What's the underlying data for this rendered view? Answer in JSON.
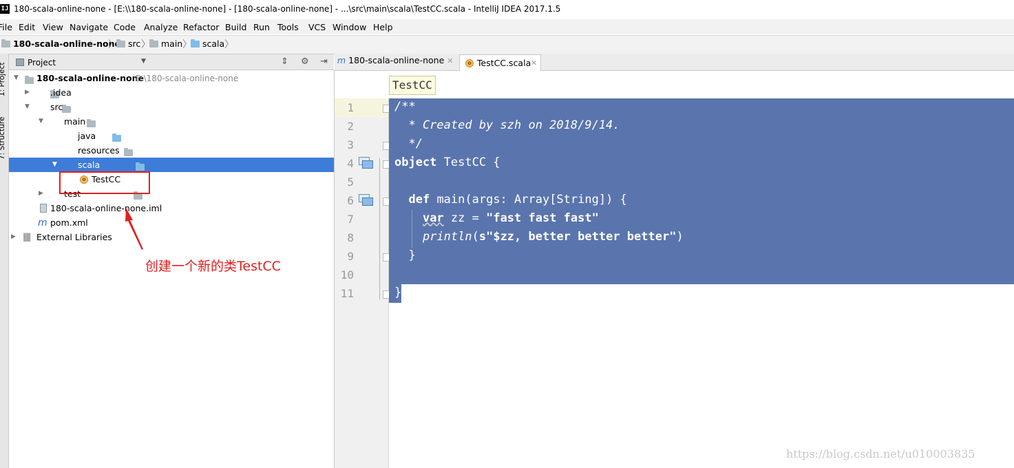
{
  "window": {
    "title": "180-scala-online-none - [E:\\\\180-scala-online-none] - [180-scala-online-none] - ...\\src\\main\\scala\\TestCC.scala - IntelliJ IDEA 2017.1.5",
    "logo": "IJ"
  },
  "menu": [
    "File",
    "Edit",
    "View",
    "Navigate",
    "Code",
    "Analyze",
    "Refactor",
    "Build",
    "Run",
    "Tools",
    "VCS",
    "Window",
    "Help"
  ],
  "navbar": {
    "project": "180-scala-online-none",
    "crumbs": [
      "src",
      "main",
      "scala"
    ]
  },
  "side_tabs": {
    "project": "1: Project",
    "structure": "7: Structure"
  },
  "project_panel": {
    "title": "Project",
    "tree": {
      "root_name": "180-scala-online-none",
      "root_path": "E:\\180-scala-online-none",
      "idea": ".idea",
      "src": "src",
      "main": "main",
      "java": "java",
      "resources": "resources",
      "scala": "scala",
      "testcc": "TestCC",
      "test": "test",
      "iml": "180-scala-online-none.iml",
      "pom": "pom.xml",
      "ext_libs": "External Libraries"
    }
  },
  "annotation": {
    "text": "创建一个新的类TestCC",
    "color": "#e02020"
  },
  "editor": {
    "tabs": [
      {
        "label": "180-scala-online-none",
        "icon": "maven-icon",
        "active": false
      },
      {
        "label": "TestCC.scala",
        "icon": "scala-object-icon",
        "active": true
      }
    ],
    "breadcrumb_tip": "TestCC",
    "line_numbers": [
      "1",
      "2",
      "3",
      "4",
      "5",
      "6",
      "7",
      "8",
      "9",
      "10",
      "11"
    ],
    "code": {
      "l1": "/**",
      "l2": "  * Created by szh on 2018/9/14.",
      "l3": "  */",
      "l4_kw": "object",
      "l4_rest": " TestCC {",
      "l6_kw": "def",
      "l6_rest": " main(args: Array[String]) {",
      "l7_kw": "var",
      "l7_mid": " zz = ",
      "l7_str": "\"fast fast fast\"",
      "l8_fn": "println",
      "l8_a": "(",
      "l8_str": "s\"$zz, better better better\"",
      "l8_b": ")",
      "l9": "}",
      "l11": "}"
    },
    "selection_color": "#5a74ad"
  },
  "watermark": "https://blog.csdn.net/u010003835"
}
